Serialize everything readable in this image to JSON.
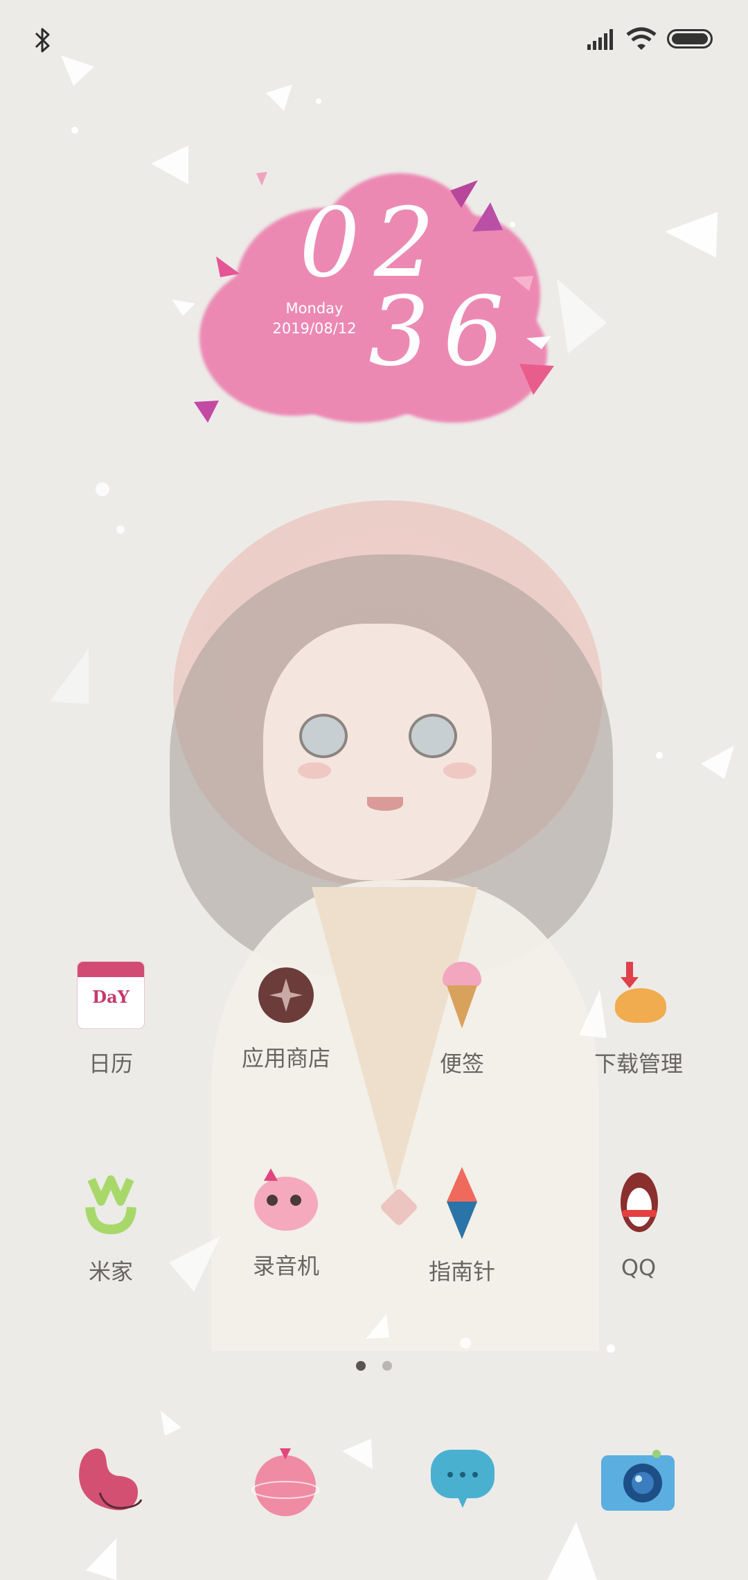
{
  "status": {
    "bluetooth_icon": "bluetooth-icon",
    "signal_icon": "signal-icon",
    "wifi_icon": "wifi-icon",
    "battery_icon": "battery-icon"
  },
  "clock": {
    "hours": "02",
    "minutes": "36",
    "day": "Monday",
    "date": "2019/08/12"
  },
  "apps_row1": [
    {
      "label": "日历",
      "icon": "calendar-icon"
    },
    {
      "label": "应用商店",
      "icon": "app-store-icon"
    },
    {
      "label": "便签",
      "icon": "notes-icon"
    },
    {
      "label": "下载管理",
      "icon": "download-manager-icon"
    }
  ],
  "apps_row2": [
    {
      "label": "米家",
      "icon": "mijia-icon"
    },
    {
      "label": "录音机",
      "icon": "recorder-icon"
    },
    {
      "label": "指南针",
      "icon": "compass-icon"
    },
    {
      "label": "QQ",
      "icon": "qq-icon"
    }
  ],
  "pager": {
    "pages": 2,
    "current": 1
  },
  "dock": [
    {
      "icon": "phone-icon"
    },
    {
      "icon": "browser-icon"
    },
    {
      "icon": "messages-icon"
    },
    {
      "icon": "camera-icon"
    }
  ],
  "colors": {
    "background": "#ecebe8",
    "cloud": "#ec89b3",
    "label": "#676462"
  }
}
